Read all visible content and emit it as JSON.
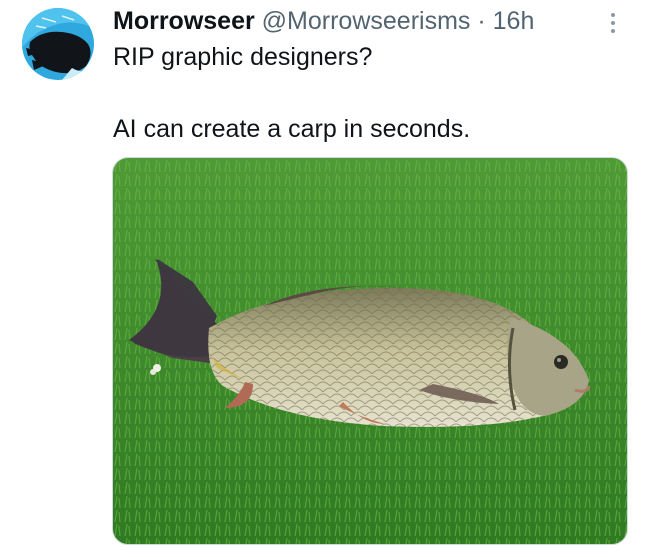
{
  "tweet": {
    "author_name": "Morrowseer",
    "author_handle": "@Morrowseerisms",
    "separator": "·",
    "timestamp": "16h",
    "text_line_1": "RIP graphic designers?",
    "text_line_2": "AI can create a carp in seconds."
  },
  "media": {
    "subject": "carp fish lying on grass",
    "icon": "photo"
  },
  "colors": {
    "text_primary": "#0f1419",
    "text_secondary": "#536471",
    "avatar_blue": "#2aa6de",
    "grass": "#3f8a2c"
  }
}
